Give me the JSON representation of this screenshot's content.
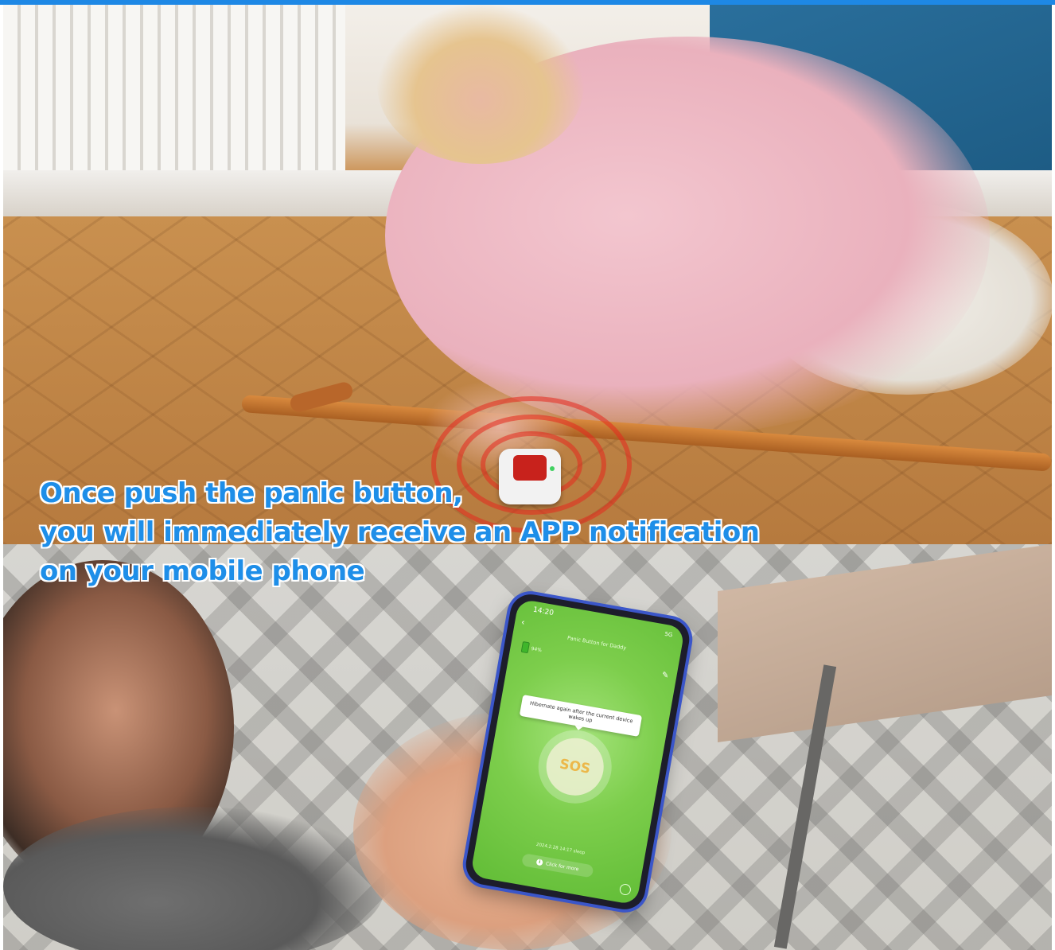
{
  "caption": {
    "line1": "Once push the panic button,",
    "line2": "you will immediately receive an APP notification",
    "line3": "on your mobile phone"
  },
  "phone_screen": {
    "status_time": "14:20",
    "status_signal": "5G",
    "app_title": "Panic Button for Daddy",
    "battery_level": "94%",
    "tooltip_text": "Hibernate again after the current device wakes up",
    "sos_label": "SOS",
    "log_entry": "2024.2.28 14:17 sleep",
    "click_more_label": "Click for more"
  },
  "colors": {
    "caption_text": "#1e8ee8",
    "caption_outline": "#ffffff",
    "top_bar": "#1e88e5",
    "app_background": "#7dce4c",
    "panic_button_red": "#c8221c"
  }
}
